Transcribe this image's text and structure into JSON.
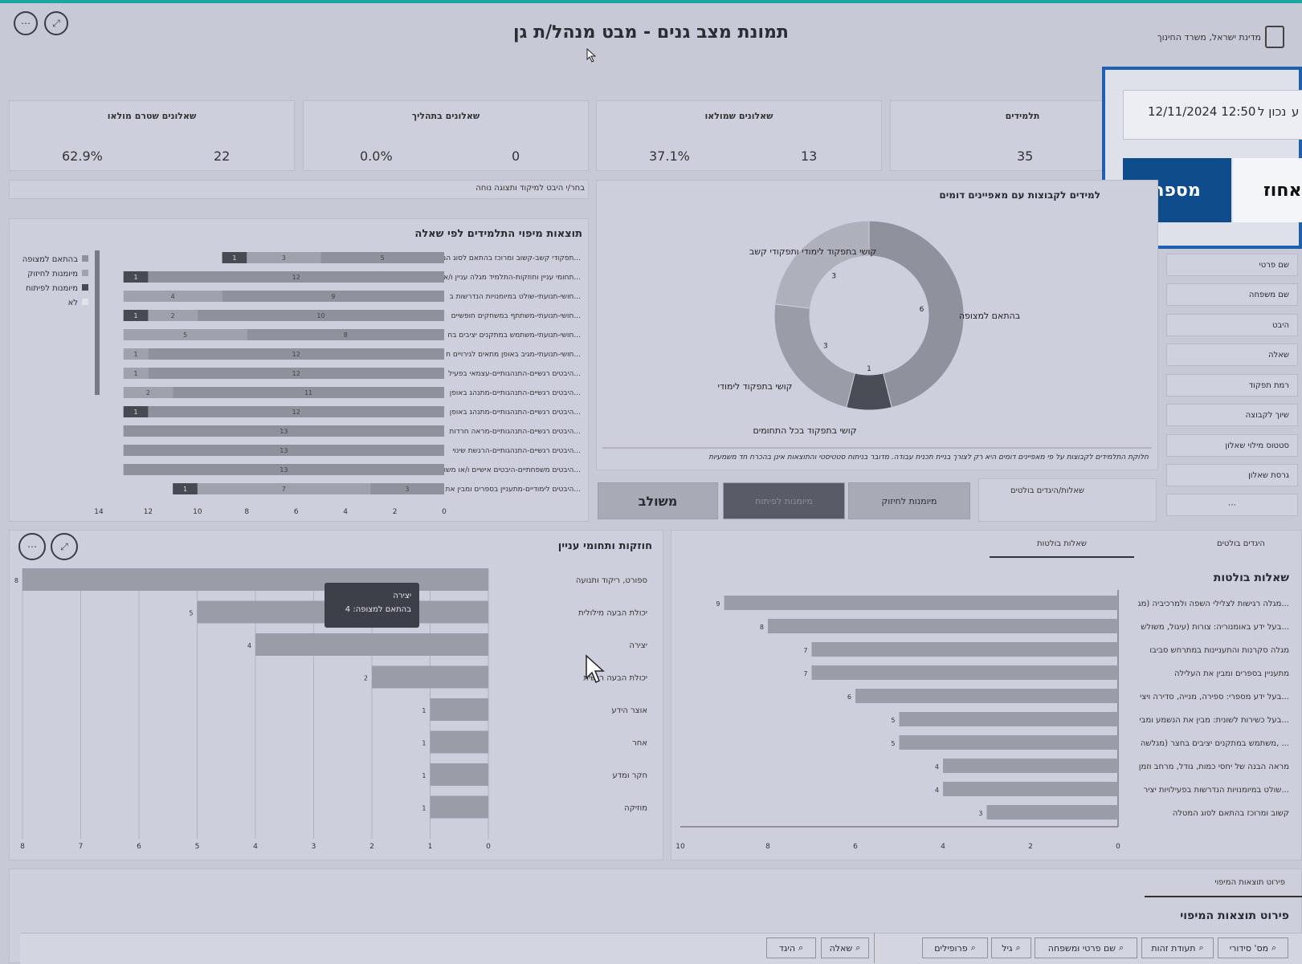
{
  "header": {
    "title": "תמונת מצב גנים - מבט מנהל/ת גן",
    "ministry": "מדינת ישראל, משרד החינוך",
    "more_label": "⋯",
    "expand_label": "⤢"
  },
  "kpis": [
    {
      "label": "תלמידים",
      "value": "35",
      "pct": ""
    },
    {
      "label": "שאלונים שמולאו",
      "value": "13",
      "pct": "37.1%"
    },
    {
      "label": "שאלונים בתהליך",
      "value": "0",
      "pct": "0.0%"
    },
    {
      "label": "שאלונים שטרם מולאו",
      "value": "22",
      "pct": "62.9%"
    }
  ],
  "info_box": {
    "date_text": "12/11/2024 12:50",
    "date_prefix": "נכון ל",
    "date_cut": "ע",
    "btn_number": "מספר",
    "btn_percent_cut": "אחוז"
  },
  "mapping_hint": "בחר/י היבט למיקוד ותצוגה נוחה",
  "donut": {
    "title_cut": "למידים לקבוצות עם מאפיינים דומים",
    "labels": [
      "קושי בתפקוד לימודי ותפקודי קשב",
      "בהתאם למצופה",
      "קושי בתפקוד לימודי",
      "קושי בתפקוד בכל התחומים"
    ],
    "note": "חלוקת התלמידים לקבוצות על פי מאפיינים דומים היא רק לצורך בניית תכנית עבודה. מדובר בניתוח סטטיסטי והתוצאות אינן בהכרח חד משמעיות"
  },
  "group_tabs": {
    "combined": "משולב",
    "dev": "מיומנות לפיתוח",
    "strength": "מיומנות לחיזוק",
    "bold_questions": "שאלות/היגדים בולטים"
  },
  "filters": {
    "items": [
      "שם פרטי",
      "שם משפחה",
      "היבט",
      "שאלה",
      "רמת תפקוד",
      "שיוך לקבוצה",
      "סטטוס מילוי שאלון",
      "גרסת שאלון"
    ],
    "more": "⋯"
  },
  "mapping_chart": {
    "title": "תוצאות מיפוי התלמידים לפי שאלה",
    "legend": [
      "בהתאם למצופה",
      "מיומנות לחיזוק",
      "מיומנות לפיתוח",
      "לא"
    ]
  },
  "strengths": {
    "title": "חוזקות ותחומי עניין",
    "tooltip_title": "יצירה",
    "tooltip_value": "בהתאם למצופה: 4"
  },
  "bold": {
    "tab_statements": "היגדים בולטים",
    "tab_questions": "שאלות בולטות",
    "title": "שאלות בולטות"
  },
  "details": {
    "tab": "פירוט תוצאות המיפוי",
    "title": "פירוט תוצאות המיפוי",
    "search_right": [
      "מס' סידורי",
      "תעודת זהות",
      "שם פרטי ומשפחה",
      "גיל",
      "פרופילים"
    ],
    "search_left": [
      "שאלה",
      "היגד"
    ]
  },
  "chart_data": [
    {
      "type": "bar",
      "title": "תוצאות מיפוי התלמידים לפי שאלה",
      "orientation": "horizontal-stacked",
      "categories": [
        "תפקודי קשב-קשוב ומרוכז בהתאם לסוג המ...",
        "תחומי עניין וחוזקות-התלמיד מגלה עניין ו/א...",
        "חושי-תנועתי-שולט במיומנויות הנדרשות ב...",
        "חושי-תנועתי-משתתף במשחקים חופשיים...",
        "חושי-תנועתי-משתמש במתקנים יציבים בח...",
        "חושי-תנועתי-מגיב באופן מתאים לגירויים ח...",
        "היבטים רגשיים-התנהגותיים-עצמאי בפעיל...",
        "היבטים רגשיים-התנהגותיים-מתנהג באופן...",
        "היבטים רגשיים-התנהגותיים-מתנהג באופן...",
        "היבטים רגשיים-התנהגותיים-מראה חרדות...",
        "היבטים רגשיים-התנהגותיים-הרגשת שינוי...",
        "היבטים משפחתיים-היבטים אישיים ו/או משו...",
        "היבטים לימודיים-מתעניין בספרים ומבין את..."
      ],
      "series": [
        {
          "name": "בהתאם למצופה",
          "values": [
            5,
            12,
            9,
            10,
            8,
            12,
            12,
            11,
            12,
            13,
            13,
            13,
            3
          ]
        },
        {
          "name": "מיומנות לחיזוק",
          "values": [
            3,
            0,
            4,
            2,
            5,
            1,
            1,
            2,
            0,
            0,
            0,
            0,
            7
          ]
        },
        {
          "name": "מיומנות לפיתוח",
          "values": [
            1,
            1,
            0,
            1,
            0,
            0,
            0,
            0,
            1,
            0,
            0,
            0,
            1
          ]
        }
      ],
      "xlim": [
        0,
        14
      ],
      "xticks": [
        14,
        12,
        10,
        8,
        6,
        4,
        2,
        0
      ]
    },
    {
      "type": "pie",
      "title": "",
      "categories": [
        "בהתאם למצופה",
        "קושי בתפקוד בכל התחומים",
        "קושי בתפקוד לימודי",
        "קושי בתפקוד לימודי ותפקודי קשב"
      ],
      "values": [
        6,
        1,
        3,
        3
      ]
    },
    {
      "type": "bar",
      "title": "חוזקות ותחומי עניין",
      "orientation": "horizontal",
      "categories": [
        "ספורט, ריקוד ותנועה",
        "יכולת הבעה מילולית",
        "יצירה",
        "יכולת הבעה רגשית",
        "אוצר הידע",
        "אחר",
        "חקר ומדע",
        "מוזיקה"
      ],
      "values": [
        8,
        5,
        4,
        2,
        1,
        1,
        1,
        1
      ],
      "xlim": [
        0,
        8
      ],
      "xticks": [
        8,
        7,
        6,
        5,
        4,
        3,
        2,
        1,
        0
      ]
    },
    {
      "type": "bar",
      "title": "שאלות בולטות",
      "orientation": "horizontal",
      "categories": [
        "מגלה רגישות לצלילי השפה ולמרכיביה (מג...",
        "בעל ידע באומנוריה: צורות (עיגול, משולש...",
        "מגלה סקרנות והתעניינות במתרחש סביבו",
        "מתעניין בספרים ומבין את העלילה",
        "בעל ידע מספרי: ספירה, מנייה, סדירה ויצי...",
        "בעל כשירות לשונית: מבין את הנשמע ומבי...",
        "משתמש במתקנים יציבים בחצר (מגלשה, ...",
        "מראה הבנה של יחסי כמות, גודל, מרחב וזמן",
        "שולט במיומנויות הנדרשות בפעילויות יציר...",
        "קשוב ומרוכז בהתאם לסוג המטלה"
      ],
      "values": [
        9,
        8,
        7,
        7,
        6,
        5,
        5,
        4,
        4,
        3
      ],
      "xlim": [
        0,
        10
      ],
      "xticks": [
        10,
        8,
        6,
        4,
        2,
        0
      ]
    }
  ],
  "colors": {
    "bg": "#c7cad6",
    "panel": "#cdd0dc",
    "bar_grey": "#8f929c",
    "bar_mid": "#9fa2ac",
    "bar_dark": "#474a52",
    "highlight_blue": "#1f5fb0",
    "number_btn": "#0f4c8c",
    "teal": "#1aa6a0"
  }
}
